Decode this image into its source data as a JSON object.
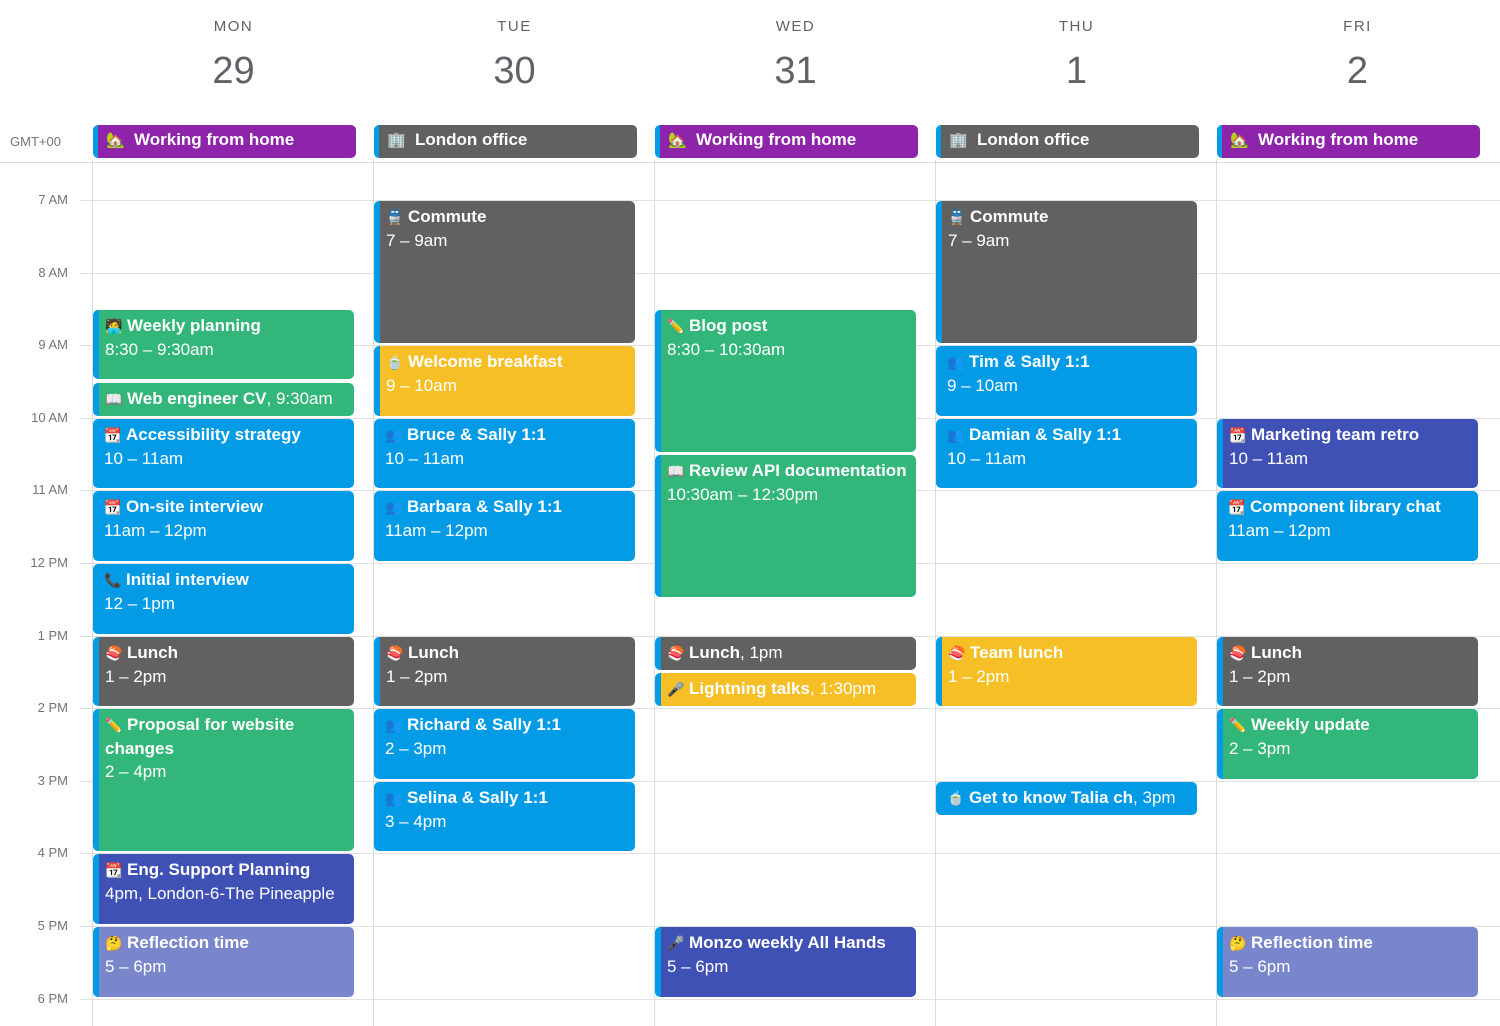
{
  "timezone": "GMT+00",
  "colors": {
    "green": "#33b679",
    "blue": "#039be5",
    "graphite": "#616161",
    "yellow": "#f6bf26",
    "purple": "#8e24aa",
    "indigo": "#3f51b5",
    "lavender": "#7986cb",
    "stripe": "#039be5"
  },
  "hours": [
    "7 AM",
    "8 AM",
    "9 AM",
    "10 AM",
    "11 AM",
    "12 PM",
    "1 PM",
    "2 PM",
    "3 PM",
    "4 PM",
    "5 PM",
    "6 PM"
  ],
  "days": [
    {
      "name": "MON",
      "num": "29",
      "allday": {
        "label": "Working from home",
        "icon": "house-with-tree-icon",
        "glyph": "🏡",
        "color": "purple"
      }
    },
    {
      "name": "TUE",
      "num": "30",
      "allday": {
        "label": "London office",
        "icon": "office-building-icon",
        "glyph": "🏢",
        "color": "graphite"
      }
    },
    {
      "name": "WED",
      "num": "31",
      "allday": {
        "label": "Working from home",
        "icon": "house-with-tree-icon",
        "glyph": "🏡",
        "color": "purple"
      }
    },
    {
      "name": "THU",
      "num": "1",
      "allday": {
        "label": "London office",
        "icon": "office-building-icon",
        "glyph": "🏢",
        "color": "graphite"
      }
    },
    {
      "name": "FRI",
      "num": "2",
      "allday": {
        "label": "Working from home",
        "icon": "house-with-tree-icon",
        "glyph": "🏡",
        "color": "purple"
      }
    }
  ],
  "events": [
    {
      "day": 0,
      "start": 8.5,
      "end": 9.5,
      "title": "Weekly planning",
      "time": "8:30 – 9:30am",
      "color": "green",
      "stripe": true,
      "icon": "technologist-icon",
      "glyph": "🧑‍💻",
      "inline": false
    },
    {
      "day": 0,
      "start": 9.5,
      "end": 10.0,
      "title": "Web engineer CV",
      "time": "9:30am",
      "color": "green",
      "stripe": true,
      "icon": "open-book-icon",
      "glyph": "📖",
      "inline": true
    },
    {
      "day": 0,
      "start": 10,
      "end": 11,
      "title": "Accessibility strategy",
      "time": "10 – 11am",
      "color": "blue",
      "stripe": false,
      "icon": "calendar-icon",
      "glyph": "📆",
      "inline": false
    },
    {
      "day": 0,
      "start": 11,
      "end": 12,
      "title": "On-site interview",
      "time": "11am – 12pm",
      "color": "blue",
      "stripe": false,
      "icon": "calendar-icon",
      "glyph": "📆",
      "inline": false
    },
    {
      "day": 0,
      "start": 12,
      "end": 13,
      "title": "Initial interview",
      "time": "12 – 1pm",
      "color": "blue",
      "stripe": false,
      "icon": "telephone-icon",
      "glyph": "📞",
      "inline": false
    },
    {
      "day": 0,
      "start": 13,
      "end": 14,
      "title": "Lunch",
      "time": "1 – 2pm",
      "color": "graphite",
      "stripe": true,
      "icon": "sushi-icon",
      "glyph": "🍣",
      "inline": false
    },
    {
      "day": 0,
      "start": 14,
      "end": 16,
      "title": "Proposal for website changes",
      "time": "2 – 4pm",
      "color": "green",
      "stripe": true,
      "icon": "pencil-icon",
      "glyph": "✏️",
      "inline": false
    },
    {
      "day": 0,
      "start": 16,
      "end": 17,
      "title": "Eng. Support Planning",
      "time": "4pm, London-6-The Pineapple",
      "color": "indigo",
      "stripe": true,
      "icon": "calendar-icon",
      "glyph": "📆",
      "inline": false
    },
    {
      "day": 0,
      "start": 17,
      "end": 18,
      "title": "Reflection time",
      "time": "5 – 6pm",
      "color": "lavender",
      "stripe": true,
      "icon": "thinking-face-icon",
      "glyph": "🤔",
      "inline": false
    },
    {
      "day": 1,
      "start": 7,
      "end": 9,
      "title": "Commute",
      "time": "7 – 9am",
      "color": "graphite",
      "stripe": true,
      "icon": "train-icon",
      "glyph": "🚆",
      "inline": false
    },
    {
      "day": 1,
      "start": 9,
      "end": 10,
      "title": "Welcome breakfast",
      "time": "9 – 10am",
      "color": "yellow",
      "stripe": true,
      "icon": "bowl-icon",
      "glyph": "🍵",
      "inline": false
    },
    {
      "day": 1,
      "start": 10,
      "end": 11,
      "title": "Bruce & Sally 1:1",
      "time": "10 – 11am",
      "color": "blue",
      "stripe": false,
      "icon": "people-icon",
      "glyph": "👥",
      "inline": false
    },
    {
      "day": 1,
      "start": 11,
      "end": 12,
      "title": "Barbara & Sally 1:1",
      "time": "11am – 12pm",
      "color": "blue",
      "stripe": false,
      "icon": "people-icon",
      "glyph": "👥",
      "inline": false
    },
    {
      "day": 1,
      "start": 13,
      "end": 14,
      "title": "Lunch",
      "time": "1 – 2pm",
      "color": "graphite",
      "stripe": true,
      "icon": "sushi-icon",
      "glyph": "🍣",
      "inline": false
    },
    {
      "day": 1,
      "start": 14,
      "end": 15,
      "title": "Richard & Sally 1:1",
      "time": "2 – 3pm",
      "color": "blue",
      "stripe": false,
      "icon": "people-icon",
      "glyph": "👥",
      "inline": false
    },
    {
      "day": 1,
      "start": 15,
      "end": 16,
      "title": "Selina & Sally 1:1",
      "time": "3 – 4pm",
      "color": "blue",
      "stripe": false,
      "icon": "people-icon",
      "glyph": "👥",
      "inline": false
    },
    {
      "day": 2,
      "start": 8.5,
      "end": 10.5,
      "title": "Blog post",
      "time": "8:30 – 10:30am",
      "color": "green",
      "stripe": true,
      "icon": "pencil-icon",
      "glyph": "✏️",
      "inline": false
    },
    {
      "day": 2,
      "start": 10.5,
      "end": 12.5,
      "title": "Review API documentation",
      "time": "10:30am – 12:30pm",
      "color": "green",
      "stripe": true,
      "icon": "open-book-icon",
      "glyph": "📖",
      "inline": false
    },
    {
      "day": 2,
      "start": 13,
      "end": 13.5,
      "title": "Lunch",
      "time": "1pm",
      "color": "graphite",
      "stripe": true,
      "icon": "sushi-icon",
      "glyph": "🍣",
      "inline": true
    },
    {
      "day": 2,
      "start": 13.5,
      "end": 14,
      "title": "Lightning talks",
      "time": "1:30pm",
      "color": "yellow",
      "stripe": true,
      "icon": "microphone-icon",
      "glyph": "🎤",
      "inline": true
    },
    {
      "day": 2,
      "start": 17,
      "end": 18,
      "title": "Monzo weekly All Hands",
      "time": "5 – 6pm",
      "color": "indigo",
      "stripe": true,
      "icon": "microphone-icon",
      "glyph": "🎤",
      "inline": false
    },
    {
      "day": 3,
      "start": 7,
      "end": 9,
      "title": "Commute",
      "time": "7 – 9am",
      "color": "graphite",
      "stripe": true,
      "icon": "train-icon",
      "glyph": "🚆",
      "inline": false
    },
    {
      "day": 3,
      "start": 9,
      "end": 10,
      "title": "Tim & Sally 1:1",
      "time": "9 – 10am",
      "color": "blue",
      "stripe": false,
      "icon": "people-icon",
      "glyph": "👥",
      "inline": false
    },
    {
      "day": 3,
      "start": 10,
      "end": 11,
      "title": "Damian & Sally 1:1",
      "time": "10 – 11am",
      "color": "blue",
      "stripe": false,
      "icon": "people-icon",
      "glyph": "👥",
      "inline": false
    },
    {
      "day": 3,
      "start": 13,
      "end": 14,
      "title": "Team lunch",
      "time": "1 – 2pm",
      "color": "yellow",
      "stripe": true,
      "icon": "sushi-icon",
      "glyph": "🍣",
      "inline": false
    },
    {
      "day": 3,
      "start": 15,
      "end": 15.5,
      "title": "Get to know Talia ch",
      "time": "3pm",
      "color": "blue",
      "stripe": false,
      "icon": "bowl-icon",
      "glyph": "🍵",
      "inline": true
    },
    {
      "day": 4,
      "start": 10,
      "end": 11,
      "title": "Marketing team retro",
      "time": "10 – 11am",
      "color": "indigo",
      "stripe": true,
      "icon": "calendar-icon",
      "glyph": "📆",
      "inline": false
    },
    {
      "day": 4,
      "start": 11,
      "end": 12,
      "title": "Component library chat",
      "time": "11am – 12pm",
      "color": "blue",
      "stripe": false,
      "icon": "calendar-icon",
      "glyph": "📆",
      "inline": false
    },
    {
      "day": 4,
      "start": 13,
      "end": 14,
      "title": "Lunch",
      "time": "1 – 2pm",
      "color": "graphite",
      "stripe": true,
      "icon": "sushi-icon",
      "glyph": "🍣",
      "inline": false
    },
    {
      "day": 4,
      "start": 14,
      "end": 15,
      "title": "Weekly update",
      "time": "2 – 3pm",
      "color": "green",
      "stripe": true,
      "icon": "pencil-icon",
      "glyph": "✏️",
      "inline": false
    },
    {
      "day": 4,
      "start": 17,
      "end": 18,
      "title": "Reflection time",
      "time": "5 – 6pm",
      "color": "lavender",
      "stripe": true,
      "icon": "thinking-face-icon",
      "glyph": "🤔",
      "inline": false
    }
  ]
}
